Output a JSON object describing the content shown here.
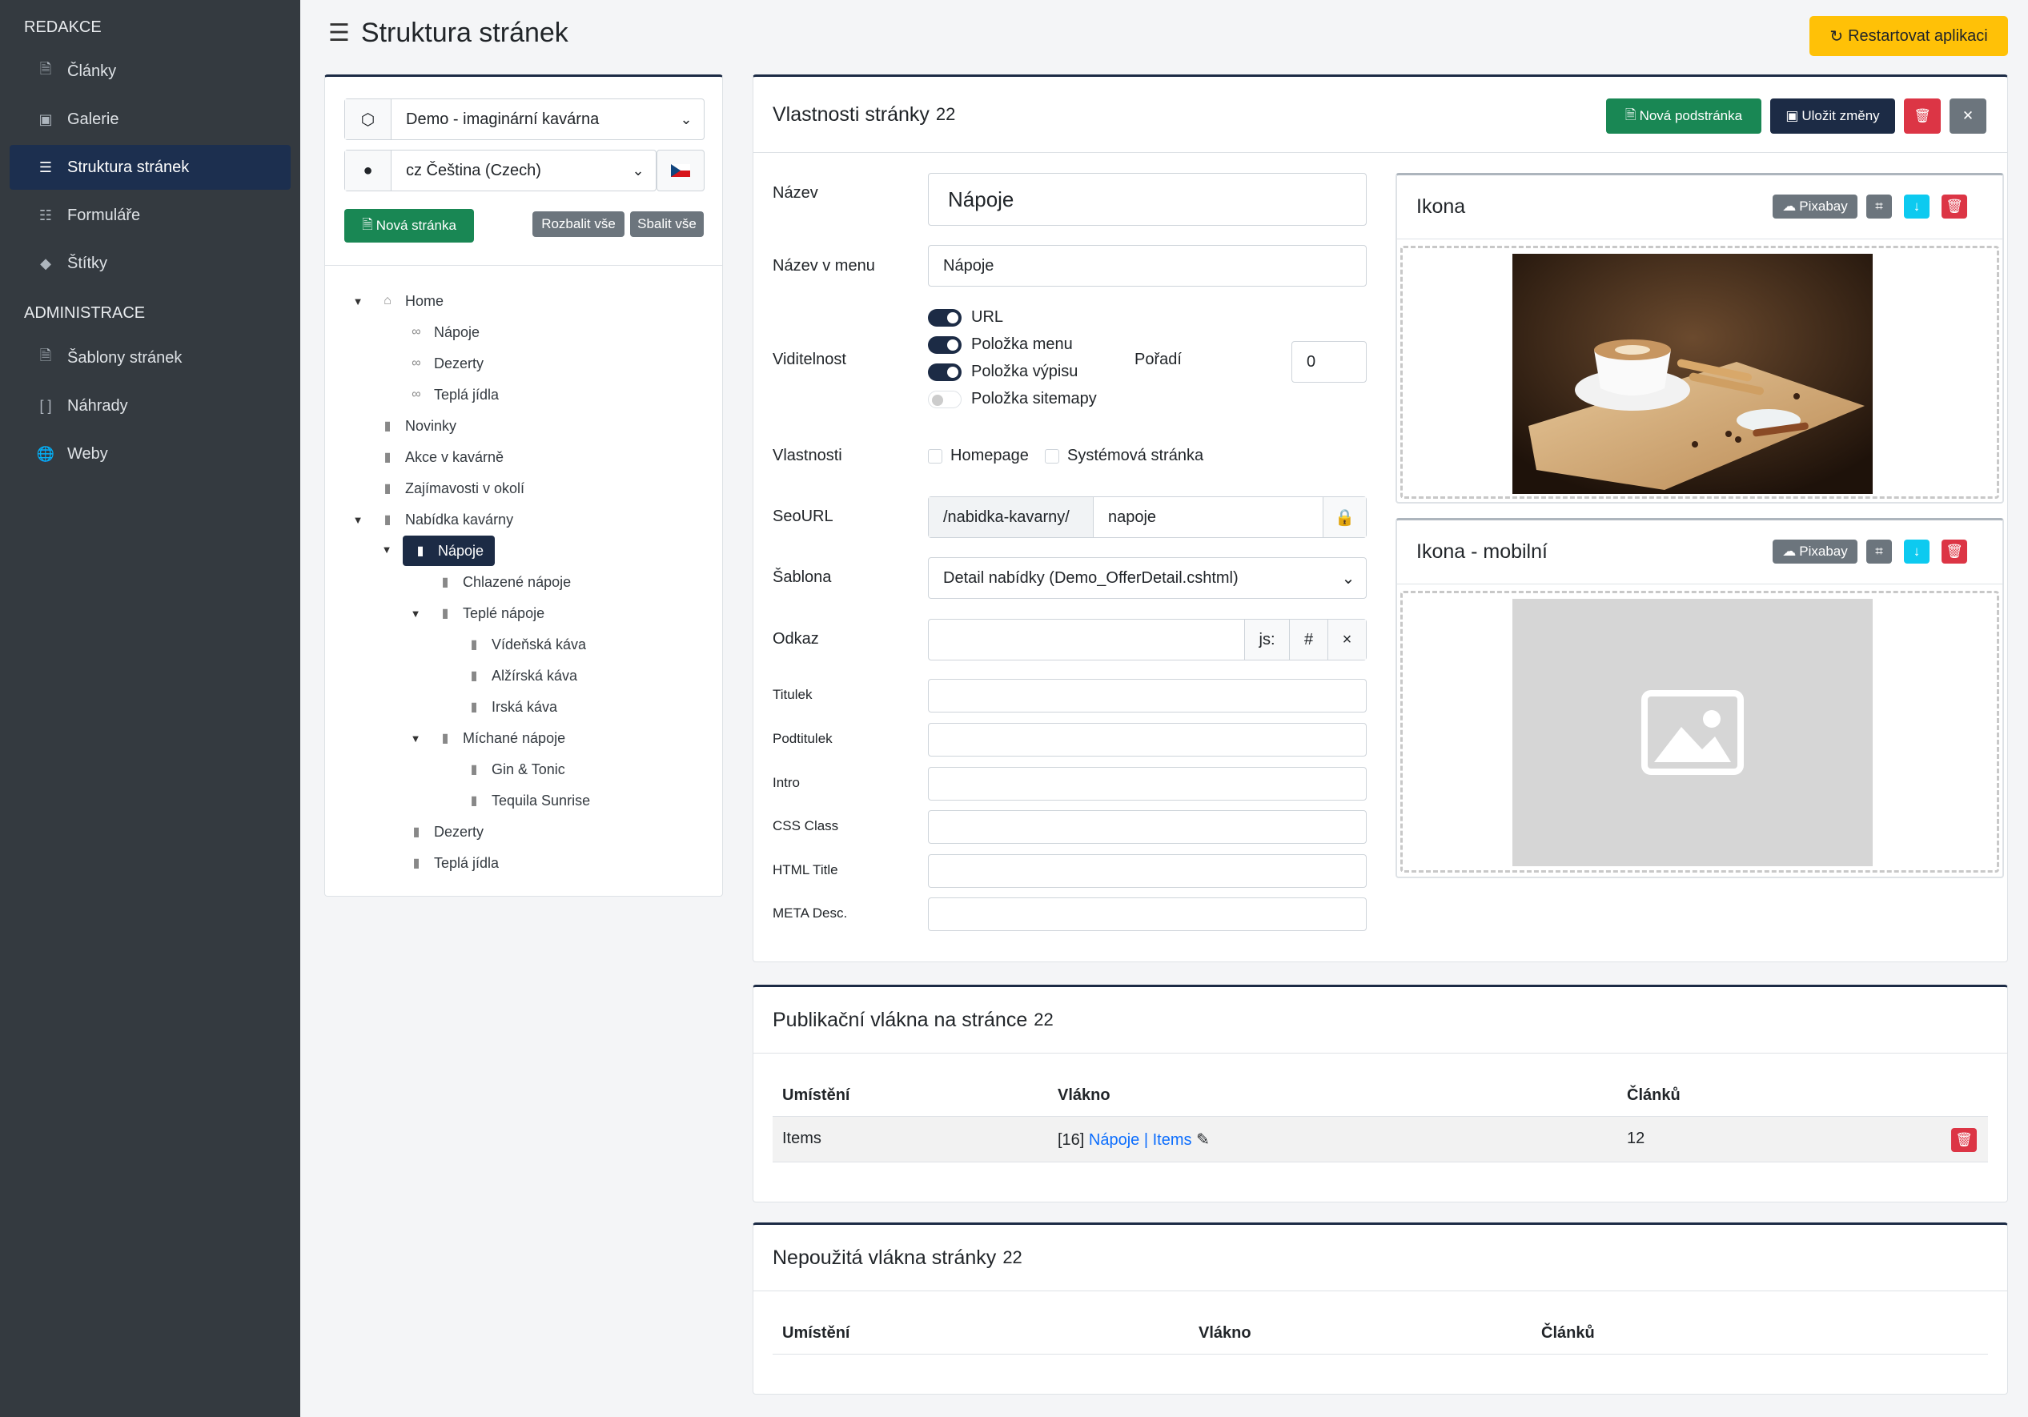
{
  "sidebar": {
    "section_redakce": "REDAKCE",
    "section_admin": "ADMINISTRACE",
    "items": [
      {
        "label": "Články",
        "icon": "file-icon"
      },
      {
        "label": "Galerie",
        "icon": "image-icon"
      },
      {
        "label": "Struktura stránek",
        "icon": "tree-icon",
        "active": true
      },
      {
        "label": "Formuláře",
        "icon": "form-icon"
      },
      {
        "label": "Štítky",
        "icon": "tag-icon"
      },
      {
        "label": "Šablony stránek",
        "icon": "template-icon"
      },
      {
        "label": "Náhrady",
        "icon": "brackets-icon"
      },
      {
        "label": "Weby",
        "icon": "globe-icon"
      }
    ]
  },
  "header": {
    "title": "Struktura stránek",
    "restart_label": "Restartovat aplikaci"
  },
  "tree_panel": {
    "site_select": "Demo - imaginární kavárna",
    "lang_select": "cz Čeština (Czech)",
    "new_page_label": "Nová stránka",
    "expand_all": "Rozbalit vše",
    "collapse_all": "Sbalit vše",
    "nodes": [
      "Home",
      "Nápoje",
      "Dezerty",
      "Teplá jídla",
      "Novinky",
      "Akce v kavárně",
      "Zajímavosti v okolí",
      "Nabídka kavárny",
      "Nápoje",
      "Chlazené nápoje",
      "Teplé nápoje",
      "Vídeňská káva",
      "Alžírská káva",
      "Irská káva",
      "Míchané nápoje",
      "Gin & Tonic",
      "Tequila Sunrise",
      "Dezerty",
      "Teplá jídla"
    ]
  },
  "props": {
    "title": "Vlastnosti stránky",
    "page_id": "22",
    "new_subpage": "Nová podstránka",
    "save_changes": "Uložit změny",
    "labels": {
      "nazev": "Název",
      "nazev_menu": "Název v menu",
      "viditelnost": "Viditelnost",
      "poradi": "Pořadí",
      "vlastnosti": "Vlastnosti",
      "seourl": "SeoURL",
      "sablona": "Šablona",
      "odkaz": "Odkaz",
      "titulek": "Titulek",
      "podtitulek": "Podtitulek",
      "intro": "Intro",
      "css": "CSS Class",
      "html_title": "HTML Title",
      "meta": "META Desc."
    },
    "values": {
      "nazev": "Nápoje",
      "nazev_menu": "Nápoje",
      "poradi": "0",
      "seo_prefix": "/nabidka-kavarny/",
      "seo_slug": "napoje",
      "sablona": "Detail nabídky (Demo_OfferDetail.cshtml)",
      "odkaz_js": "js:",
      "odkaz_hash": "#",
      "odkaz_x": "×"
    },
    "toggles": [
      {
        "label": "URL",
        "on": true
      },
      {
        "label": "Položka menu",
        "on": true
      },
      {
        "label": "Položka výpisu",
        "on": true
      },
      {
        "label": "Položka sitemapy",
        "on": false
      }
    ],
    "checkboxes": [
      "Homepage",
      "Systémová stránka"
    ],
    "icon_panel": {
      "title": "Ikona",
      "pixabay": "Pixabay"
    },
    "icon_mobile_panel": {
      "title": "Ikona - mobilní",
      "pixabay": "Pixabay"
    }
  },
  "pub_threads": {
    "title": "Publikační vlákna na stránce",
    "page_id": "22",
    "columns": [
      "Umístění",
      "Vlákno",
      "Článků"
    ],
    "rows": [
      {
        "umisteni": "Items",
        "vlakno_id": "[16]",
        "vlakno_link": "Nápoje | Items",
        "clanku": "12"
      }
    ]
  },
  "unused_threads": {
    "title": "Nepoužitá vlákna stránky",
    "page_id": "22",
    "columns": [
      "Umístění",
      "Vlákno",
      "Článků"
    ]
  },
  "colors": {
    "sidebar_bg": "#343a40",
    "active_navy": "#1c2b45",
    "green": "#198754",
    "warning": "#ffc107",
    "danger": "#dc3545"
  }
}
